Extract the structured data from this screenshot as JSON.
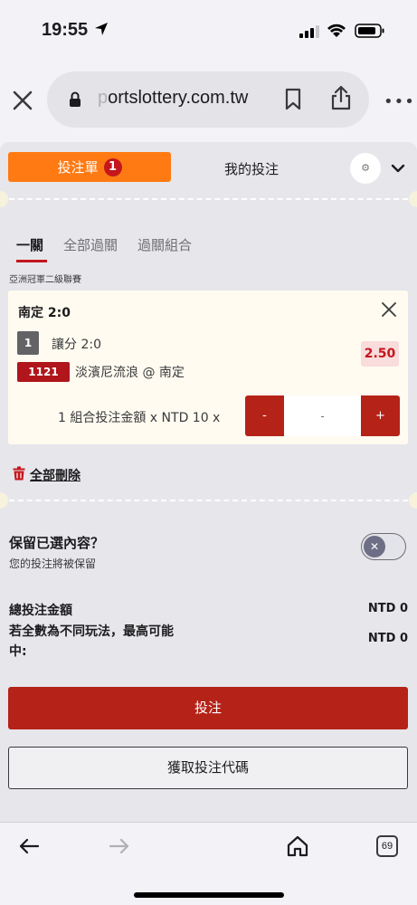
{
  "status_bar": {
    "time": "19:55"
  },
  "browser": {
    "url_faded": "p",
    "url_main": "ortslottery.com.tw",
    "tab_count": "69"
  },
  "slip": {
    "tab_label": "投注單",
    "tab_count": "1",
    "my_bets": "我的投注",
    "sub_tabs": [
      "一關",
      "全部過關",
      "過關組合"
    ],
    "league": "亞洲冠軍二級聯賽",
    "selection": {
      "title": "南定 2:0",
      "leg_no": "1",
      "market": "讓分 2:0",
      "odds": "2.50",
      "match_code": "1121",
      "match": "淡濱尼流浪 @ 南定",
      "stake_label": "1 組合投注金額 x NTD 10 x",
      "stake_placeholder": "-",
      "minus": "-",
      "plus": "+"
    },
    "delete_all": "全部刪除",
    "keep": {
      "title": "保留已選內容？",
      "subtitle": "您的投注將被保留"
    },
    "total_label": "總投注金額",
    "total_value": "NTD 0",
    "max_label_1": "若全數為不同玩法，最高可能",
    "max_label_2": "中:",
    "max_value": "NTD 0",
    "bet_button": "投注",
    "code_button": "獲取投注代碼"
  }
}
